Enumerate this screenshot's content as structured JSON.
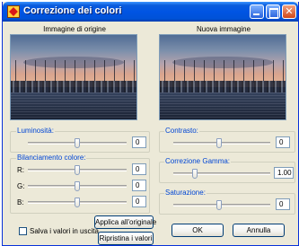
{
  "window": {
    "title": "Correzione dei colori",
    "icons": {
      "app": "color-correction-icon",
      "minimize": "minimize-icon",
      "maximize": "maximize-icon",
      "close": "close-icon"
    }
  },
  "previews": {
    "original_label": "Immagine di origine",
    "new_label": "Nuova immagine"
  },
  "adjustments": {
    "brightness": {
      "label": "Luminosità:",
      "value": "0",
      "level": 0.5
    },
    "contrast": {
      "label": "Contrasto:",
      "value": "0",
      "level": 0.5
    },
    "color_balance": {
      "label": "Bilanciamento colore:",
      "channels": [
        {
          "label": "R:",
          "value": "0",
          "level": 0.5
        },
        {
          "label": "G:",
          "value": "0",
          "level": 0.5
        },
        {
          "label": "B:",
          "value": "0",
          "level": 0.5
        }
      ]
    },
    "gamma": {
      "label": "Correzione Gamma:",
      "value": "1.00",
      "level": 0.22
    },
    "saturation": {
      "label": "Saturazione:",
      "value": "0",
      "level": 0.5
    }
  },
  "options": {
    "save_values_label": "Salva i valori in uscita",
    "save_values_checked": false
  },
  "buttons": {
    "apply_original": "Applica all'originale",
    "restore_values": "Ripristina i valori",
    "ok": "OK",
    "cancel": "Annulla"
  }
}
